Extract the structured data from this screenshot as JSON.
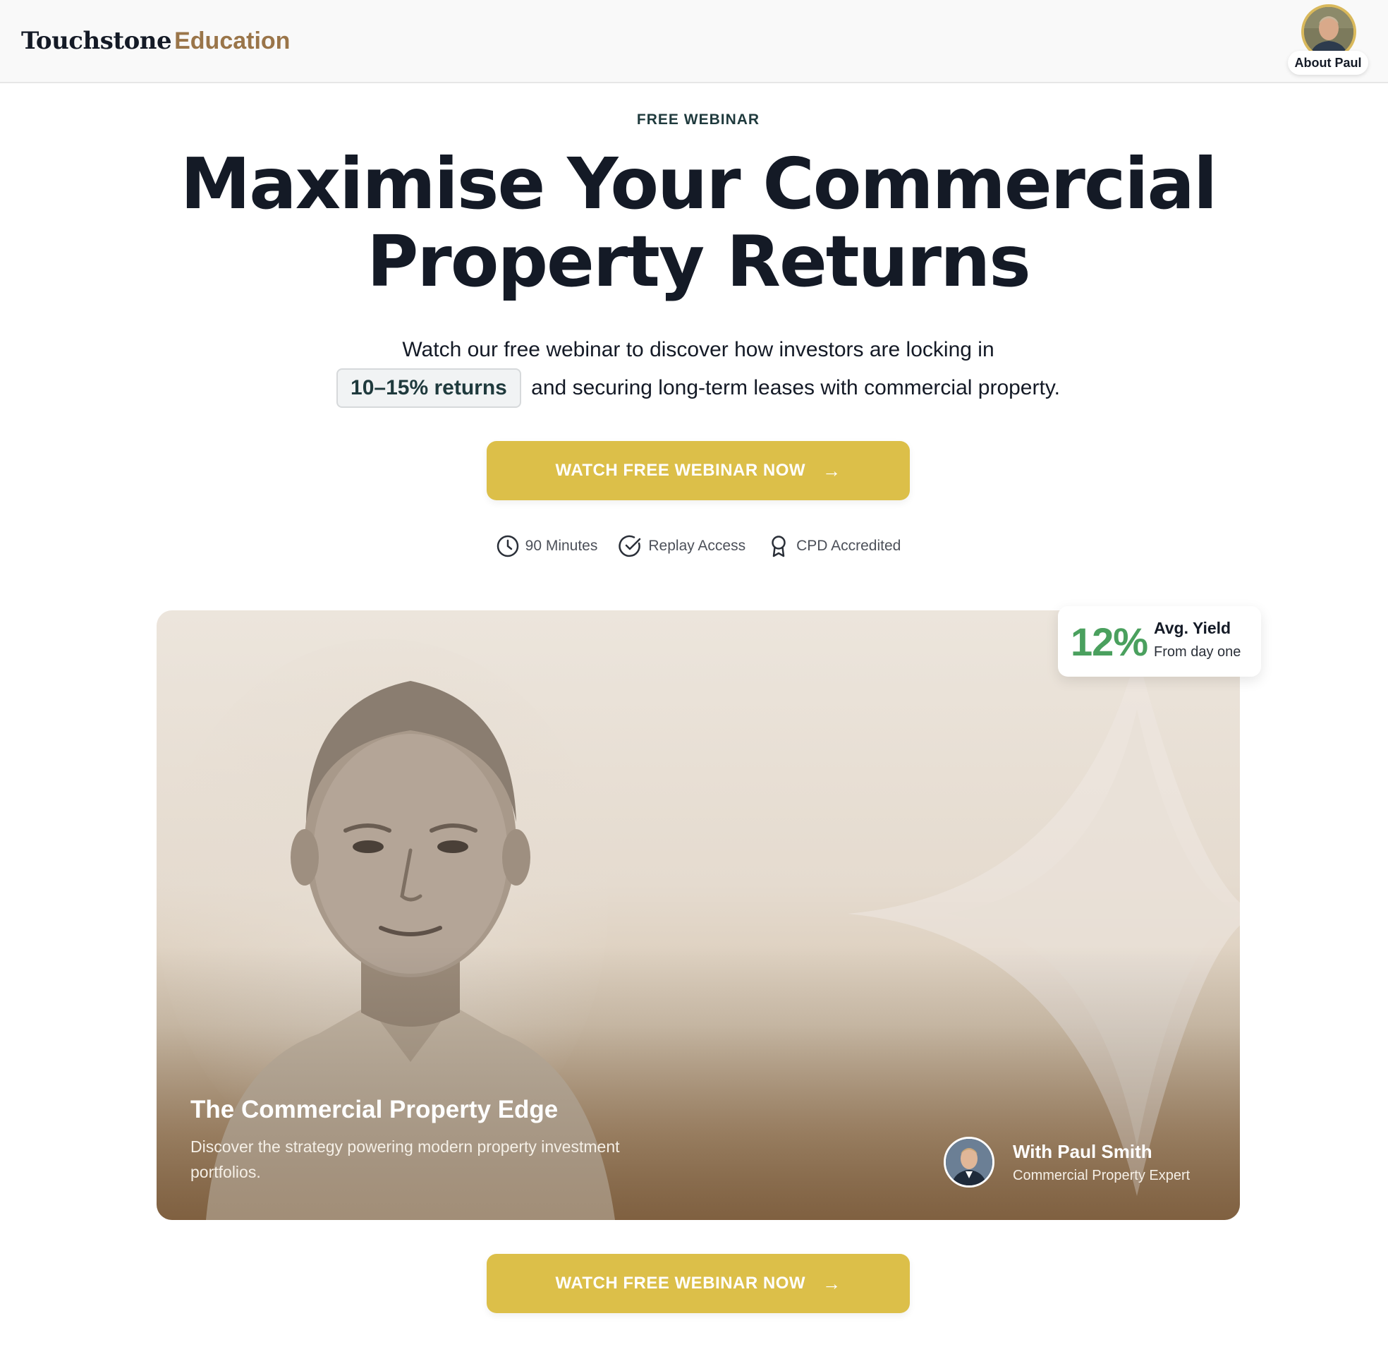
{
  "header": {
    "brand": "Touchstone",
    "brand_sub": "Education",
    "about_label": "About Paul"
  },
  "hero": {
    "eyebrow": "FREE WEBINAR",
    "headline_part1": "Maximise",
    "headline_part2": " Your Commercial",
    "headline_part3": "Property ",
    "headline_part4": "Returns",
    "sub_line1": "Watch our free webinar to discover how investors are locking in",
    "sub_highlight": "10–15% returns",
    "sub_line2": " and securing long-term leases with commercial property.",
    "cta_label": "WATCH FREE WEBINAR NOW",
    "cta_arrow": "→",
    "features": [
      {
        "icon": "clock-icon",
        "label": "90 Minutes"
      },
      {
        "icon": "check-circle-icon",
        "label": "Replay Access"
      },
      {
        "icon": "award-icon",
        "label": "CPD Accredited"
      }
    ]
  },
  "card": {
    "title": "The Commercial Property Edge",
    "description": "Discover the strategy powering modern property investment portfolios.",
    "presenter_name": "With Paul Smith",
    "presenter_role": "Commercial Property Expert"
  },
  "yield_badge": {
    "value": "12%",
    "label": "Avg. Yield",
    "sublabel": "From day one"
  },
  "bottom_cta": {
    "label": "WATCH FREE WEBINAR NOW",
    "arrow": "→"
  },
  "colors": {
    "accent_gold": "#dcbf49",
    "brand_bronze": "#9a7549",
    "yield_green": "#4aa05e",
    "headline_navy": "#141a26"
  }
}
